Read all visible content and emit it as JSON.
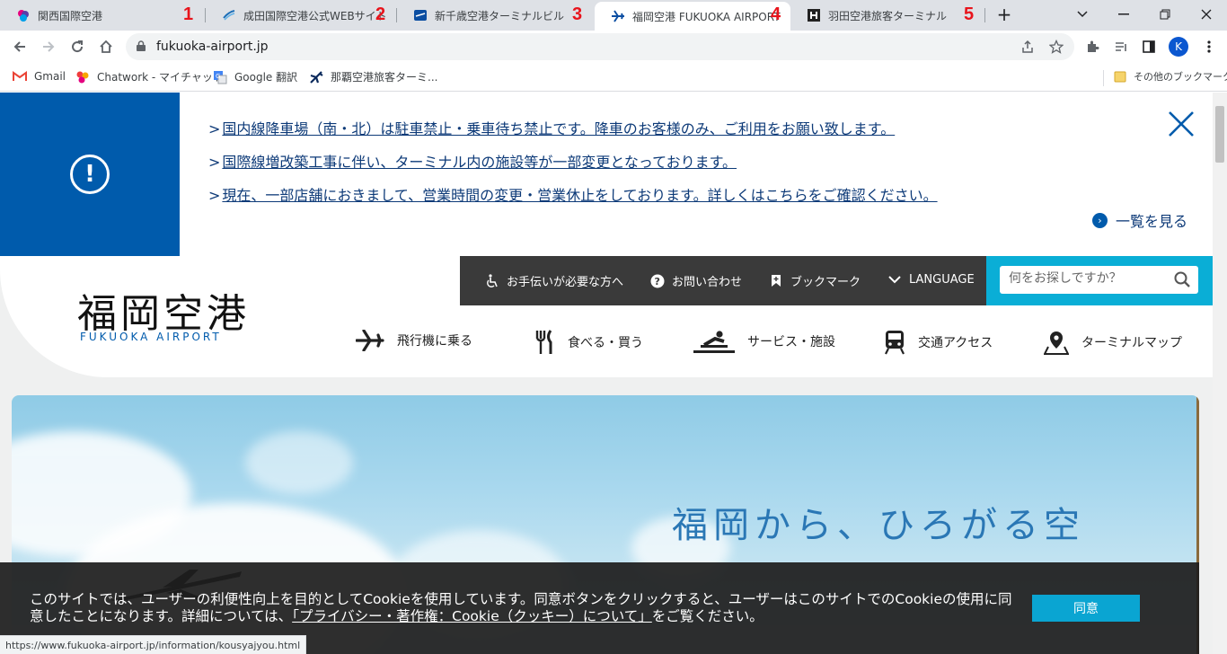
{
  "browser": {
    "tabs": [
      {
        "title": "関西国際空港",
        "number": "1",
        "icon": "kansai-favicon"
      },
      {
        "title": "成田国際空港公式WEBサイト",
        "number": "2",
        "icon": "narita-favicon"
      },
      {
        "title": "新千歳空港ターミナルビル",
        "number": "3",
        "icon": "new-chitose-favicon"
      },
      {
        "title": "福岡空港 FUKUOKA AIRPORT",
        "number": "4",
        "icon": "plane-favicon",
        "active": true
      },
      {
        "title": "羽田空港旅客ターミナル",
        "number": "5",
        "icon": "haneda-favicon"
      }
    ],
    "new_tab": "+",
    "url": "fukuoka-airport.jp",
    "profile_initial": "K",
    "bookmarks": [
      {
        "label": "Gmail",
        "icon": "gmail-icon"
      },
      {
        "label": "Chatwork - マイチャット",
        "icon": "chatwork-icon"
      },
      {
        "label": "Google 翻訳",
        "icon": "google-translate-icon"
      },
      {
        "label": "那覇空港旅客ターミ...",
        "icon": "plane-icon"
      }
    ],
    "other_bookmarks": "その他のブックマーク",
    "status_url": "https://www.fukuoka-airport.jp/information/kousyajyou.html"
  },
  "notice": {
    "items": [
      "国内線降車場（南・北）は駐車禁止・乗車待ち禁止です。降車のお客様のみ、ご利用をお願い致します。",
      "国際線増改築工事に伴い、ターミナル内の施設等が一部変更となっております。",
      "現在、一部店舗におきまして、営業時間の変更・営業休止をしております。詳しくはこちらをご確認ください。"
    ],
    "more_label": "一覧を見る"
  },
  "header": {
    "logo_jp": "福岡空港",
    "logo_en": "FUKUOKA AIRPORT",
    "utility": [
      {
        "label": "お手伝いが必要な方へ",
        "icon": "wheelchair-icon"
      },
      {
        "label": "お問い合わせ",
        "icon": "question-icon"
      },
      {
        "label": "ブックマーク",
        "icon": "bookmark-icon"
      },
      {
        "label": "LANGUAGE",
        "icon": "chevron-down-icon"
      }
    ],
    "search_placeholder": "何をお探しですか？",
    "nav": [
      {
        "label": "飛行機に乗る",
        "icon": "plane-icon"
      },
      {
        "label": "食べる・買う",
        "icon": "fork-knife-icon"
      },
      {
        "label": "サービス・施設",
        "icon": "service-icon"
      },
      {
        "label": "交通アクセス",
        "icon": "train-icon"
      },
      {
        "label": "ターミナルマップ",
        "icon": "map-pin-icon"
      }
    ]
  },
  "hero": {
    "slogan": "福岡から、ひろがる空"
  },
  "cookie": {
    "text_before": "このサイトでは、ユーザーの利便性向上を目的としてCookieを使用しています。同意ボタンをクリックすると、ユーザーはこのサイトでのCookieの使用に同意したことになります。詳細については、",
    "link": "「プライバシー・著作権：Cookie（クッキー）について」",
    "text_after": "をご覧ください。",
    "agree_label": "同意"
  },
  "colors": {
    "primary_blue": "#005bac",
    "search_cyan": "#0aaed6",
    "tab_number_red": "#e8141c",
    "util_bar": "#3a3a3a"
  }
}
